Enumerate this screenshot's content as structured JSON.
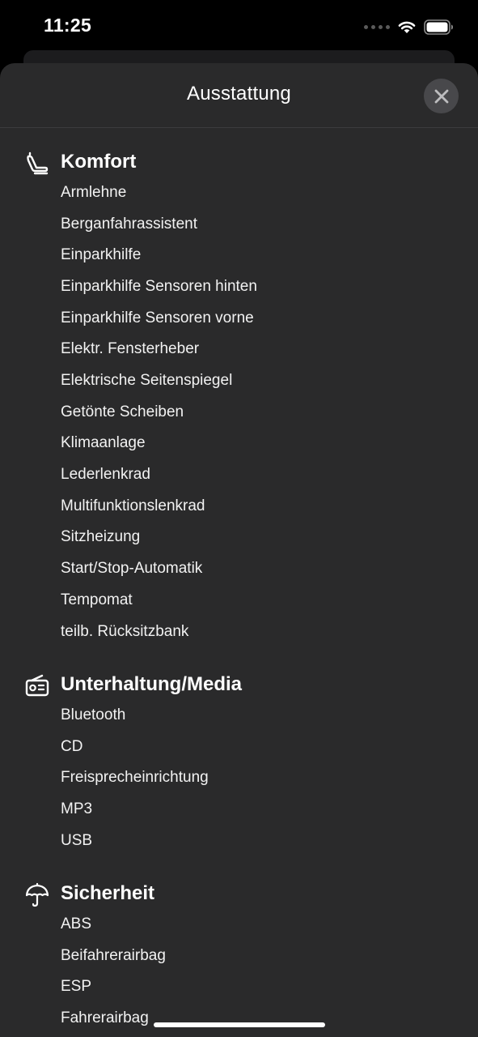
{
  "status": {
    "time": "11:25"
  },
  "sheet": {
    "title": "Ausstattung"
  },
  "sections": [
    {
      "title": "Komfort",
      "icon": "car-seat-icon",
      "items": [
        "Armlehne",
        "Berganfahrassistent",
        "Einparkhilfe",
        "Einparkhilfe Sensoren hinten",
        "Einparkhilfe Sensoren vorne",
        "Elektr. Fensterheber",
        "Elektrische Seitenspiegel",
        "Getönte Scheiben",
        "Klimaanlage",
        "Lederlenkrad",
        "Multifunktionslenkrad",
        "Sitzheizung",
        "Start/Stop-Automatik",
        "Tempomat",
        "teilb. Rücksitzbank"
      ]
    },
    {
      "title": "Unterhaltung/Media",
      "icon": "radio-icon",
      "items": [
        "Bluetooth",
        "CD",
        "Freisprecheinrichtung",
        "MP3",
        "USB"
      ]
    },
    {
      "title": "Sicherheit",
      "icon": "umbrella-icon",
      "items": [
        "ABS",
        "Beifahrerairbag",
        "ESP",
        "Fahrerairbag"
      ]
    }
  ]
}
